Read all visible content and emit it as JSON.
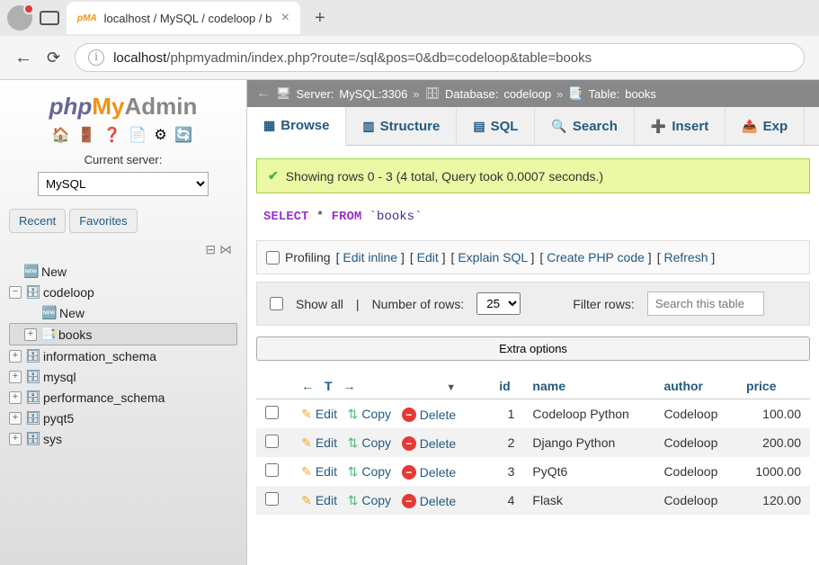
{
  "browser": {
    "tab_title": "localhost / MySQL / codeloop / b",
    "url_host": "localhost",
    "url_path": "/phpmyadmin/index.php?route=/sql&pos=0&db=codeloop&table=books"
  },
  "logo": {
    "part1": "php",
    "part2": "My",
    "part3": "Admin"
  },
  "sidebar": {
    "server_label": "Current server:",
    "server_value": "MySQL",
    "tabs": {
      "recent": "Recent",
      "favorites": "Favorites"
    },
    "tree": {
      "new": "New",
      "db": "codeloop",
      "db_new": "New",
      "table": "books",
      "others": [
        "information_schema",
        "mysql",
        "performance_schema",
        "pyqt5",
        "sys"
      ]
    }
  },
  "breadcrumb": {
    "server_label": "Server:",
    "server": "MySQL:3306",
    "db_label": "Database:",
    "db": "codeloop",
    "table_label": "Table:",
    "table": "books"
  },
  "topnav": {
    "browse": "Browse",
    "structure": "Structure",
    "sql": "SQL",
    "search": "Search",
    "insert": "Insert",
    "export": "Exp"
  },
  "success_msg": "Showing rows 0 - 3 (4 total, Query took 0.0007 seconds.)",
  "sql": {
    "select": "SELECT",
    "star": "*",
    "from": "FROM",
    "ident": "`books`"
  },
  "actions": {
    "profiling": "Profiling",
    "edit_inline": "Edit inline",
    "edit": "Edit",
    "explain": "Explain SQL",
    "create_php": "Create PHP code",
    "refresh": "Refresh"
  },
  "filter": {
    "show_all": "Show all",
    "num_rows_label": "Number of rows:",
    "num_rows_value": "25",
    "filter_label": "Filter rows:",
    "filter_placeholder": "Search this table"
  },
  "extra_options": "Extra options",
  "table": {
    "headers": {
      "id": "id",
      "name": "name",
      "author": "author",
      "price": "price"
    },
    "row_actions": {
      "edit": "Edit",
      "copy": "Copy",
      "delete": "Delete"
    },
    "rows": [
      {
        "id": "1",
        "name": "Codeloop Python",
        "author": "Codeloop",
        "price": "100.00"
      },
      {
        "id": "2",
        "name": "Django Python",
        "author": "Codeloop",
        "price": "200.00"
      },
      {
        "id": "3",
        "name": "PyQt6",
        "author": "Codeloop",
        "price": "1000.00"
      },
      {
        "id": "4",
        "name": "Flask",
        "author": "Codeloop",
        "price": "120.00"
      }
    ]
  }
}
